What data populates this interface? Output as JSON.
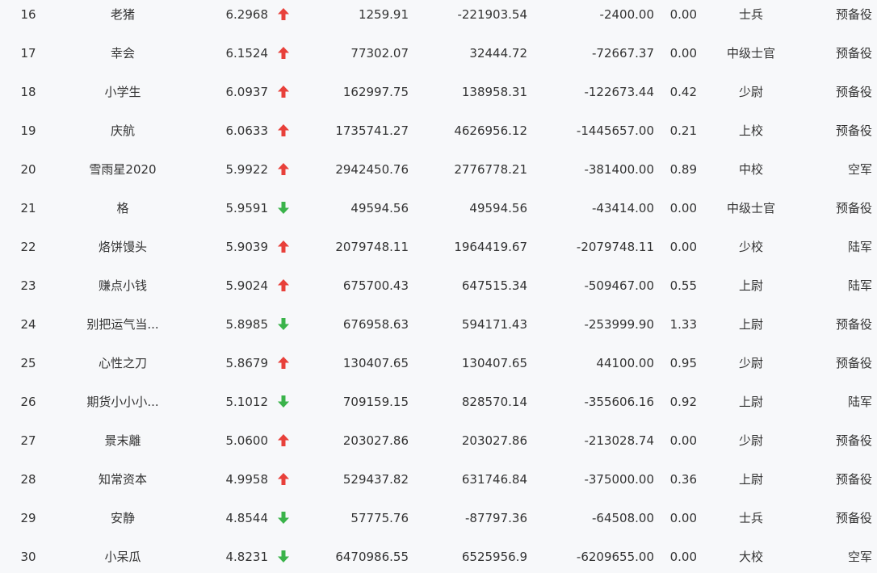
{
  "colors": {
    "up": "#e8403a",
    "down": "#3ab34a",
    "background": "#f7f8fa",
    "text": "#333333"
  },
  "rows": [
    {
      "rank": "16",
      "name": "老猪",
      "score": "6.2968",
      "trend": "up",
      "v1": "1259.91",
      "v2": "-221903.54",
      "v3": "-2400.00",
      "v4": "0.00",
      "title": "士兵",
      "branch": "预备役"
    },
    {
      "rank": "17",
      "name": "幸会",
      "score": "6.1524",
      "trend": "up",
      "v1": "77302.07",
      "v2": "32444.72",
      "v3": "-72667.37",
      "v4": "0.00",
      "title": "中级士官",
      "branch": "预备役"
    },
    {
      "rank": "18",
      "name": "小学生",
      "score": "6.0937",
      "trend": "up",
      "v1": "162997.75",
      "v2": "138958.31",
      "v3": "-122673.44",
      "v4": "0.42",
      "title": "少尉",
      "branch": "预备役"
    },
    {
      "rank": "19",
      "name": "庆航",
      "score": "6.0633",
      "trend": "up",
      "v1": "1735741.27",
      "v2": "4626956.12",
      "v3": "-1445657.00",
      "v4": "0.21",
      "title": "上校",
      "branch": "预备役"
    },
    {
      "rank": "20",
      "name": "雪雨星2020",
      "score": "5.9922",
      "trend": "up",
      "v1": "2942450.76",
      "v2": "2776778.21",
      "v3": "-381400.00",
      "v4": "0.89",
      "title": "中校",
      "branch": "空军"
    },
    {
      "rank": "21",
      "name": "格",
      "score": "5.9591",
      "trend": "down",
      "v1": "49594.56",
      "v2": "49594.56",
      "v3": "-43414.00",
      "v4": "0.00",
      "title": "中级士官",
      "branch": "预备役"
    },
    {
      "rank": "22",
      "name": "烙饼馒头",
      "score": "5.9039",
      "trend": "up",
      "v1": "2079748.11",
      "v2": "1964419.67",
      "v3": "-2079748.11",
      "v4": "0.00",
      "title": "少校",
      "branch": "陆军"
    },
    {
      "rank": "23",
      "name": "赚点小钱",
      "score": "5.9024",
      "trend": "up",
      "v1": "675700.43",
      "v2": "647515.34",
      "v3": "-509467.00",
      "v4": "0.55",
      "title": "上尉",
      "branch": "陆军"
    },
    {
      "rank": "24",
      "name": "别把运气当...",
      "score": "5.8985",
      "trend": "down",
      "v1": "676958.63",
      "v2": "594171.43",
      "v3": "-253999.90",
      "v4": "1.33",
      "title": "上尉",
      "branch": "预备役"
    },
    {
      "rank": "25",
      "name": "心性之刀",
      "score": "5.8679",
      "trend": "up",
      "v1": "130407.65",
      "v2": "130407.65",
      "v3": "44100.00",
      "v4": "0.95",
      "title": "少尉",
      "branch": "预备役"
    },
    {
      "rank": "26",
      "name": "期货小小小...",
      "score": "5.1012",
      "trend": "down",
      "v1": "709159.15",
      "v2": "828570.14",
      "v3": "-355606.16",
      "v4": "0.92",
      "title": "上尉",
      "branch": "陆军"
    },
    {
      "rank": "27",
      "name": "景末離",
      "score": "5.0600",
      "trend": "up",
      "v1": "203027.86",
      "v2": "203027.86",
      "v3": "-213028.74",
      "v4": "0.00",
      "title": "少尉",
      "branch": "预备役"
    },
    {
      "rank": "28",
      "name": "知常资本",
      "score": "4.9958",
      "trend": "up",
      "v1": "529437.82",
      "v2": "631746.84",
      "v3": "-375000.00",
      "v4": "0.36",
      "title": "上尉",
      "branch": "预备役"
    },
    {
      "rank": "29",
      "name": "安静",
      "score": "4.8544",
      "trend": "down",
      "v1": "57775.76",
      "v2": "-87797.36",
      "v3": "-64508.00",
      "v4": "0.00",
      "title": "士兵",
      "branch": "预备役"
    },
    {
      "rank": "30",
      "name": "小呆瓜",
      "score": "4.8231",
      "trend": "down",
      "v1": "6470986.55",
      "v2": "6525956.9",
      "v3": "-6209655.00",
      "v4": "0.00",
      "title": "大校",
      "branch": "空军"
    }
  ]
}
